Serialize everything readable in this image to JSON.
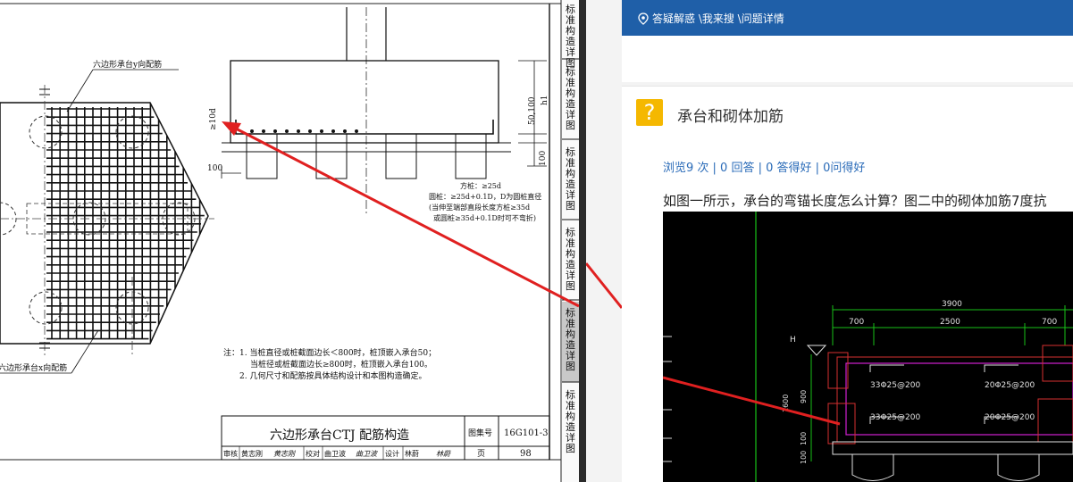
{
  "left_drawing": {
    "labels": {
      "y_rebar": "六边形承台y向配筋",
      "x_rebar": "六边形承台x向配筋",
      "dim_10d": "≥10d",
      "dim_50_100": "50,100",
      "dim_h1": "h1",
      "dim_100_left": "100",
      "dim_100_right": "100",
      "square_pile": "方桩：≥25d",
      "round_pile_1": "圆桩：≥25d+0.1D，D为圆桩直径",
      "round_pile_2": "(当伸至端部直段长度方桩≥35d",
      "round_pile_3": "或圆桩≥35d+0.1D时可不弯折)"
    },
    "notes": {
      "line1": "注：1. 当桩直径或桩截面边长＜800时，桩顶嵌入承台50；",
      "line2": "当桩径或桩截面边长≥800时，桩顶嵌入承台100。",
      "line3": "2. 几何尺寸和配筋按具体结构设计和本图构造确定。"
    },
    "title_block": {
      "title": "六边形承台CTJ 配筋构造",
      "atlas_label": "图集号",
      "atlas_no": "16G101-3",
      "page_label": "页",
      "page_no": "98",
      "row": [
        "审核",
        "黄志刚",
        "黄志刚",
        "校对",
        "曲卫波",
        "曲卫波",
        "设计",
        "林蔚",
        "林蔚"
      ]
    }
  },
  "sidebar_tabs": [
    "标准构造详图",
    "标准构造详图",
    "标准构造详图",
    "标准构造详图",
    "标准构造详图",
    "标准构造详图"
  ],
  "right_page": {
    "breadcrumb": "答疑解惑 \\我来搜 \\问题详情",
    "question_title": "承台和砌体加筋",
    "stats": "浏览9 次 | 0 回答 | 0 答得好 | 0问得好",
    "description": "如图一所示，承台的弯锚长度怎么计算？图二中的砌体加筋7度抗",
    "cad": {
      "dim_total": "3900",
      "dim_left": "700",
      "dim_mid": "2500",
      "dim_right": "700",
      "mark_h": "H",
      "rebar_1": "33Φ25@200",
      "rebar_2": "20Φ25@200",
      "rebar_3": "33Φ25@200",
      "rebar_4": "20Φ25@200",
      "dim_v1": "1600",
      "dim_v2": "900",
      "dim_v3": "100",
      "dim_v4": "100"
    }
  },
  "colors": {
    "header_blue": "#1f5fa8",
    "link_blue": "#2a6bb8",
    "arrow_red": "#e02020",
    "question_icon": "#f5b800"
  }
}
